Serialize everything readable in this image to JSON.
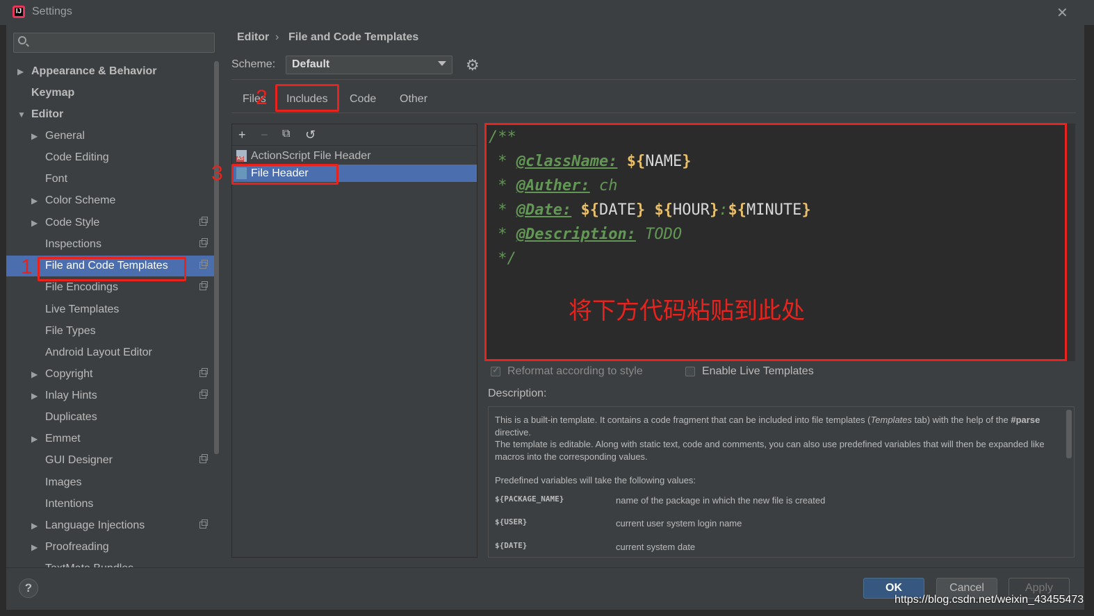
{
  "window": {
    "title": "Settings",
    "app_icon_text": "IJ"
  },
  "breadcrumb": {
    "parent": "Editor",
    "separator": "›",
    "page": "File and Code Templates"
  },
  "scheme": {
    "label": "Scheme:",
    "value": "Default"
  },
  "tabs": [
    {
      "label": "Files"
    },
    {
      "label": "Includes"
    },
    {
      "label": "Code"
    },
    {
      "label": "Other"
    }
  ],
  "sidebar": {
    "items": [
      {
        "label": "Appearance & Behavior"
      },
      {
        "label": "Keymap"
      },
      {
        "label": "Editor"
      },
      {
        "label": "General"
      },
      {
        "label": "Code Editing"
      },
      {
        "label": "Font"
      },
      {
        "label": "Color Scheme"
      },
      {
        "label": "Code Style"
      },
      {
        "label": "Inspections"
      },
      {
        "label": "File and Code Templates"
      },
      {
        "label": "File Encodings"
      },
      {
        "label": "Live Templates"
      },
      {
        "label": "File Types"
      },
      {
        "label": "Android Layout Editor"
      },
      {
        "label": "Copyright"
      },
      {
        "label": "Inlay Hints"
      },
      {
        "label": "Duplicates"
      },
      {
        "label": "Emmet"
      },
      {
        "label": "GUI Designer"
      },
      {
        "label": "Images"
      },
      {
        "label": "Intentions"
      },
      {
        "label": "Language Injections"
      },
      {
        "label": "Proofreading"
      },
      {
        "label": "TextMate Bundles"
      }
    ]
  },
  "templates": [
    {
      "label": "ActionScript File Header"
    },
    {
      "label": "File Header"
    }
  ],
  "toolbar": {
    "add": "+",
    "remove": "−",
    "copy": "⧉",
    "reset": "↺"
  },
  "code": {
    "l1": "/**",
    "l2_star": " * ",
    "l2_tag": "@className:",
    "l2_sp": " ",
    "l2_var_open": "${",
    "l2_var": "NAME",
    "l2_var_close": "}",
    "l3_star": " * ",
    "l3_tag": "@Auther:",
    "l3_text": " ch",
    "l4_star": " * ",
    "l4_tag": "@Date:",
    "l4_sp": " ",
    "l4_v1o": "${",
    "l4_v1": "DATE",
    "l4_v1c": "}",
    "l4_sp2": " ",
    "l4_v2o": "${",
    "l4_v2": "HOUR",
    "l4_v2c": "}",
    "l4_colon": ":",
    "l4_v3o": "${",
    "l4_v3": "MINUTE",
    "l4_v3c": "}",
    "l5_star": " * ",
    "l5_tag": "@Description:",
    "l5_text": " TODO",
    "l6": " */"
  },
  "annotations": {
    "one": "1",
    "two": "2",
    "three": "3",
    "paste_note": "将下方代码粘贴到此处"
  },
  "options": {
    "reformat": "Reformat according to style",
    "live_templates": "Enable Live Templates"
  },
  "description": {
    "title": "Description:",
    "p1_a": "This is a built-in template. It contains a code fragment that can be included into file templates (",
    "p1_em": "Templates",
    "p1_b": " tab) with the help of the ",
    "p1_bold": "#parse",
    "p1_c": " directive.",
    "p2": "The template is editable. Along with static text, code and comments, you can also use predefined variables that will then be expanded like macros into the corresponding values.",
    "p3": "Predefined variables will take the following values:",
    "vars": [
      {
        "name": "${PACKAGE_NAME}",
        "desc": "name of the package in which the new file is created"
      },
      {
        "name": "${USER}",
        "desc": "current user system login name"
      },
      {
        "name": "${DATE}",
        "desc": "current system date"
      }
    ]
  },
  "buttons": {
    "ok": "OK",
    "cancel": "Cancel",
    "apply": "Apply",
    "help": "?"
  },
  "watermark": "https://blog.csdn.net/weixin_43455473",
  "colors": {
    "accent": "#4b6eaf",
    "annotation_red": "#e8221d",
    "background": "#3c3f41"
  }
}
